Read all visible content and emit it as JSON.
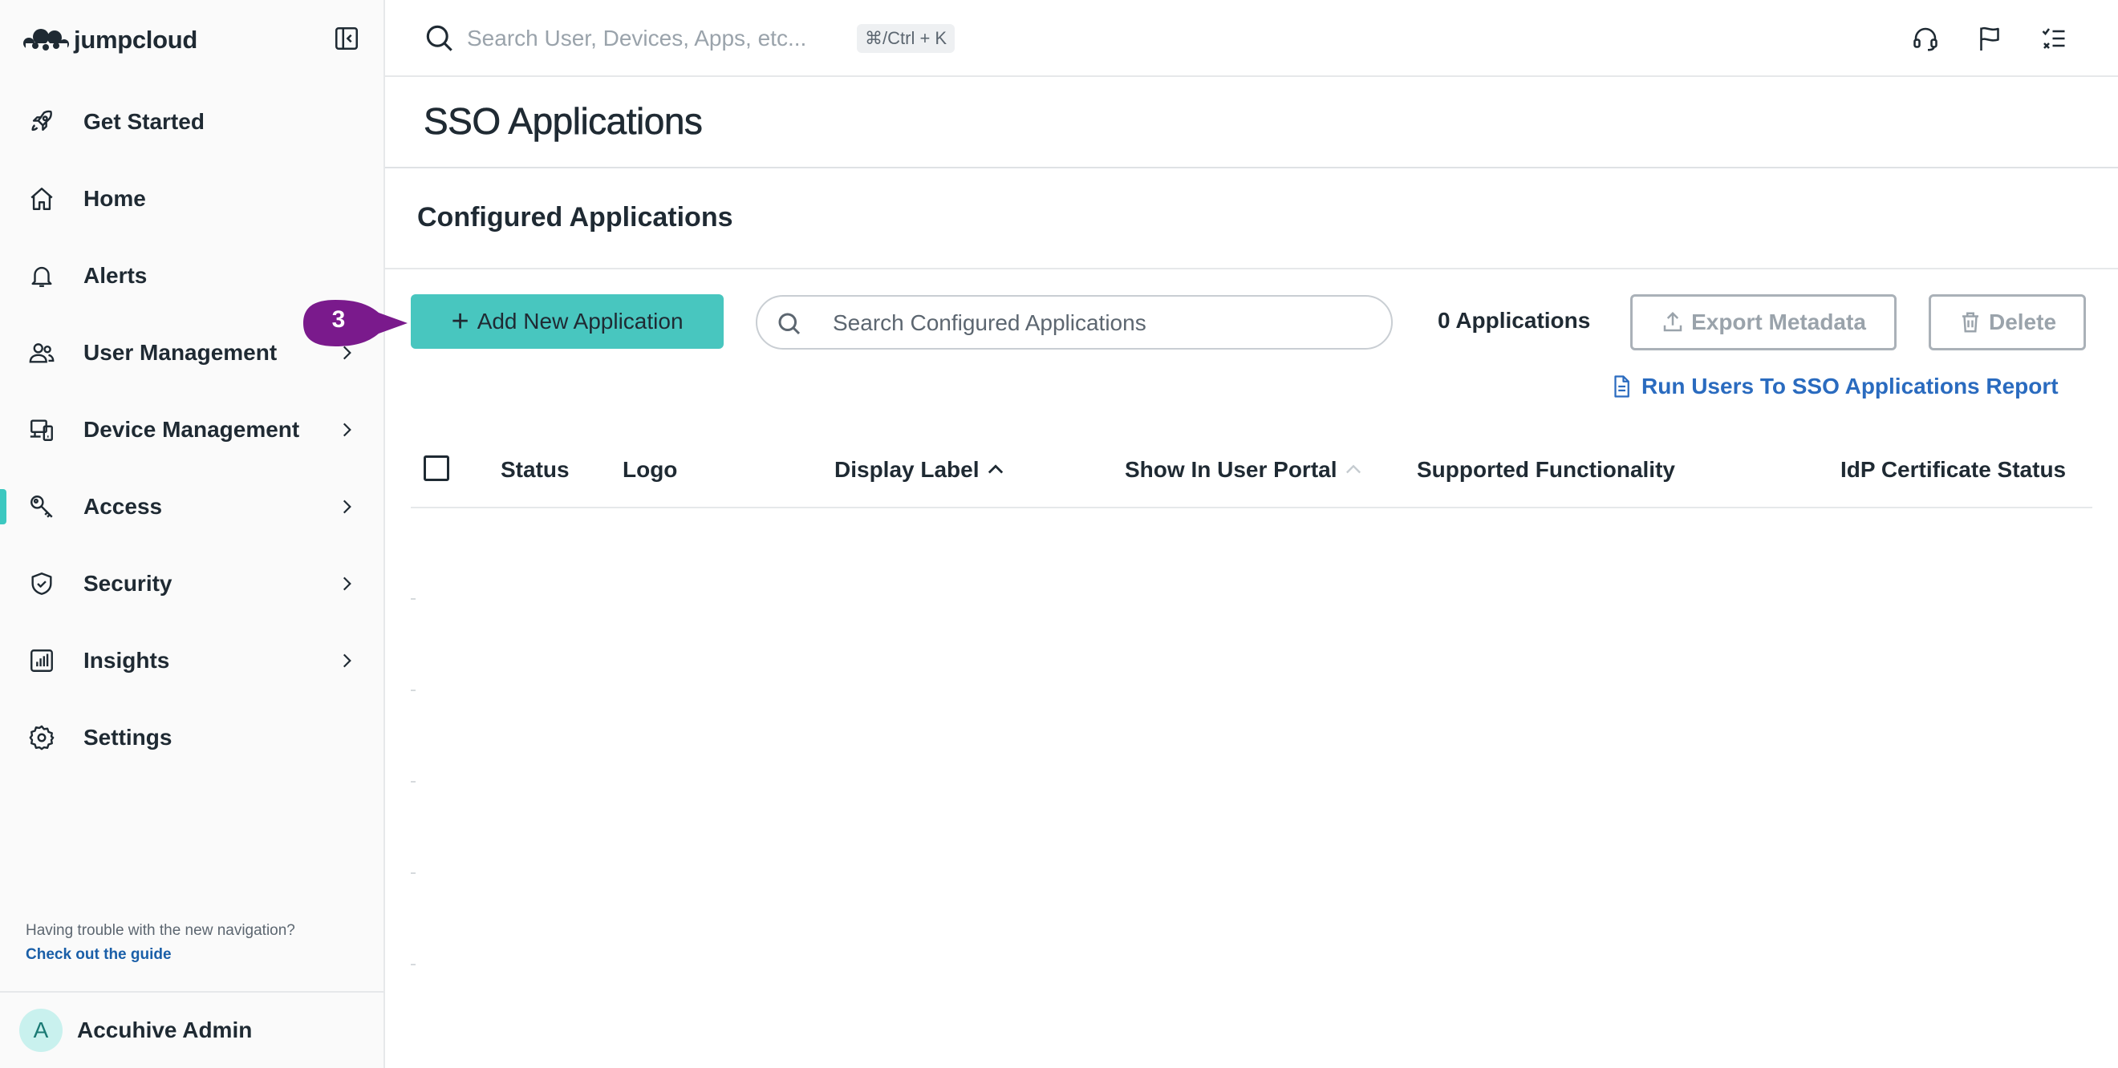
{
  "brand": {
    "name": "jumpcloud"
  },
  "search": {
    "placeholder": "Search User, Devices, Apps, etc...",
    "shortcut": "⌘/Ctrl + K"
  },
  "sidebar": {
    "items": [
      {
        "label": "Get Started",
        "icon": "rocket-icon",
        "has_children": false
      },
      {
        "label": "Home",
        "icon": "home-icon",
        "has_children": false
      },
      {
        "label": "Alerts",
        "icon": "bell-icon",
        "has_children": false
      },
      {
        "label": "User Management",
        "icon": "users-icon",
        "has_children": true
      },
      {
        "label": "Device Management",
        "icon": "devices-icon",
        "has_children": true
      },
      {
        "label": "Access",
        "icon": "key-icon",
        "has_children": true,
        "active": true
      },
      {
        "label": "Security",
        "icon": "shield-icon",
        "has_children": true
      },
      {
        "label": "Insights",
        "icon": "chart-icon",
        "has_children": true
      },
      {
        "label": "Settings",
        "icon": "gear-icon",
        "has_children": false
      }
    ],
    "help_text": "Having trouble with the new navigation?",
    "help_link": "Check out the guide",
    "user": {
      "initial": "A",
      "name": "Accuhive Admin"
    }
  },
  "topbar": {
    "icons": [
      "headset-icon",
      "flag-icon",
      "checklist-icon"
    ]
  },
  "page": {
    "title": "SSO Applications",
    "section_title": "Configured Applications"
  },
  "toolbar": {
    "add_label": "Add New Application",
    "step_number": "3",
    "search_placeholder": "Search Configured Applications",
    "count_label": "0 Applications",
    "export_label": "Export Metadata",
    "delete_label": "Delete",
    "report_label": "Run Users To SSO Applications Report"
  },
  "table": {
    "columns": [
      "Status",
      "Logo",
      "Display Label",
      "Show In User Portal",
      "Supported Functionality",
      "IdP Certificate Status"
    ],
    "rows": []
  },
  "colors": {
    "accent": "#48c6bf",
    "callout": "#7a1a8c",
    "link": "#2a6bbf"
  }
}
